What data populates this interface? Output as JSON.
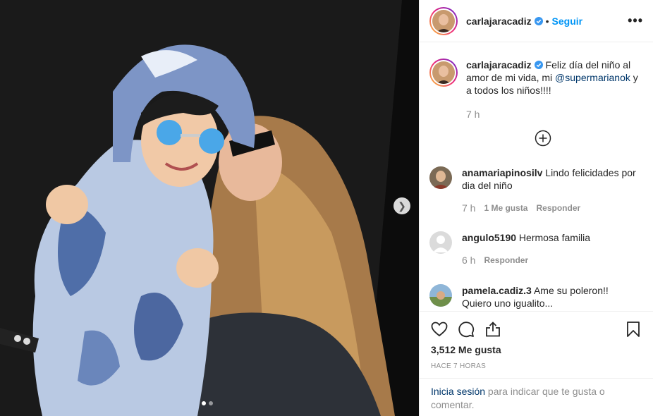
{
  "post": {
    "username": "carlajaracadiz",
    "separator": "•",
    "follow_label": "Seguir",
    "more_label": "•••",
    "caption_text_before": "Feliz día del niño al amor de mi vida, mi ",
    "caption_mention": "@supermarianok",
    "caption_text_after": " y a todos los niños!!!!",
    "caption_time": "7 h",
    "likes": "3,512 Me gusta",
    "posted_ago": "HACE 7 HORAS",
    "carousel_index": 1,
    "carousel_total": 2
  },
  "comments": [
    {
      "username": "anamariapinosilv",
      "text": "Lindo felicidades por dia del niño",
      "time": "7 h",
      "likes": "1 Me gusta",
      "reply": "Responder"
    },
    {
      "username": "angulo5190",
      "text": "Hermosa familia",
      "time": "6 h",
      "likes": "",
      "reply": "Responder"
    },
    {
      "username": "pamela.cadiz.3",
      "text": "Ame su poleron!! Quiero uno igualito...",
      "time": "",
      "likes": "",
      "reply": ""
    }
  ],
  "footer": {
    "login_link": "Inicia sesión",
    "login_text": " para indicar que te gusta o comentar."
  },
  "colors": {
    "accent": "#0095f6",
    "mention": "#00376b",
    "muted": "#8e8e8e"
  },
  "icons": [
    "more-options-icon",
    "verified-badge-icon",
    "heart-icon",
    "comment-icon",
    "share-icon",
    "bookmark-icon",
    "load-more-icon",
    "chevron-right-icon"
  ]
}
